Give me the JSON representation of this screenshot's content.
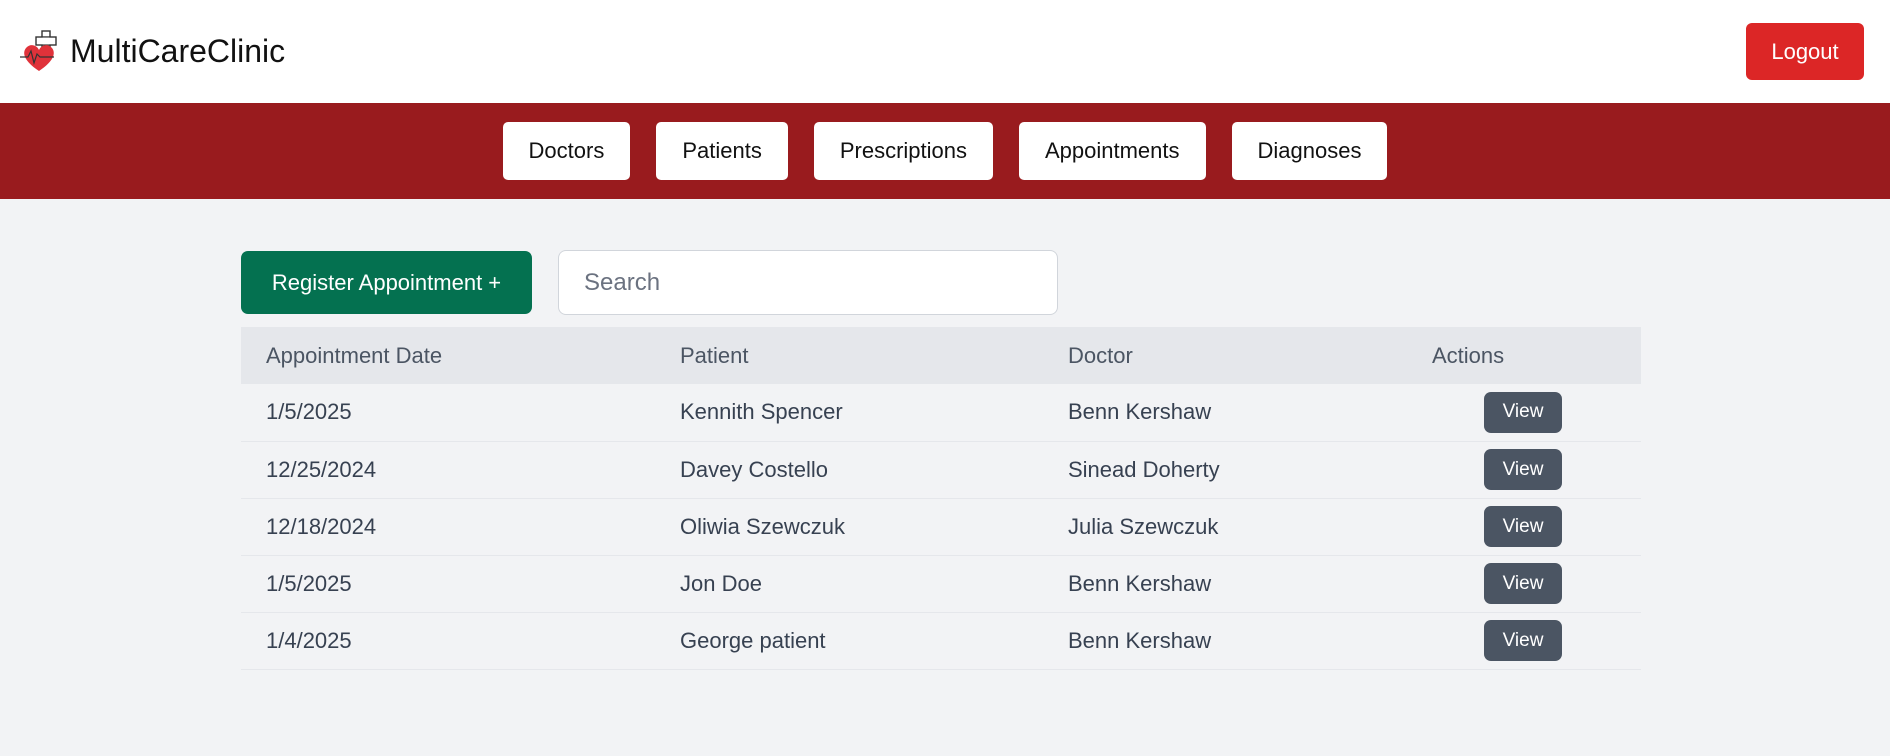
{
  "header": {
    "brand_name": "MultiCareClinic",
    "logout_label": "Logout"
  },
  "nav": {
    "items": [
      {
        "label": "Doctors"
      },
      {
        "label": "Patients"
      },
      {
        "label": "Prescriptions"
      },
      {
        "label": "Appointments"
      },
      {
        "label": "Diagnoses"
      }
    ]
  },
  "toolbar": {
    "register_label": "Register Appointment +",
    "search_placeholder": "Search",
    "search_value": ""
  },
  "table": {
    "columns": [
      "Appointment Date",
      "Patient",
      "Doctor",
      "Actions"
    ],
    "rows": [
      {
        "date": "1/5/2025",
        "patient": "Kennith Spencer",
        "doctor": "Benn Kershaw",
        "action": "View"
      },
      {
        "date": "12/25/2024",
        "patient": "Davey Costello",
        "doctor": "Sinead Doherty",
        "action": "View"
      },
      {
        "date": "12/18/2024",
        "patient": "Oliwia Szewczuk",
        "doctor": "Julia Szewczuk",
        "action": "View"
      },
      {
        "date": "1/5/2025",
        "patient": "Jon Doe",
        "doctor": "Benn Kershaw",
        "action": "View"
      },
      {
        "date": "1/4/2025",
        "patient": "George patient",
        "doctor": "Benn Kershaw",
        "action": "View"
      }
    ]
  },
  "colors": {
    "header_bg": "#ffffff",
    "nav_bg": "#991b1e",
    "logout_bg": "#dc2626",
    "register_bg": "#047150",
    "view_bg": "#4b5563",
    "page_bg": "#f2f3f5"
  },
  "icons": {
    "logo": "heart-cross-logo-icon"
  }
}
